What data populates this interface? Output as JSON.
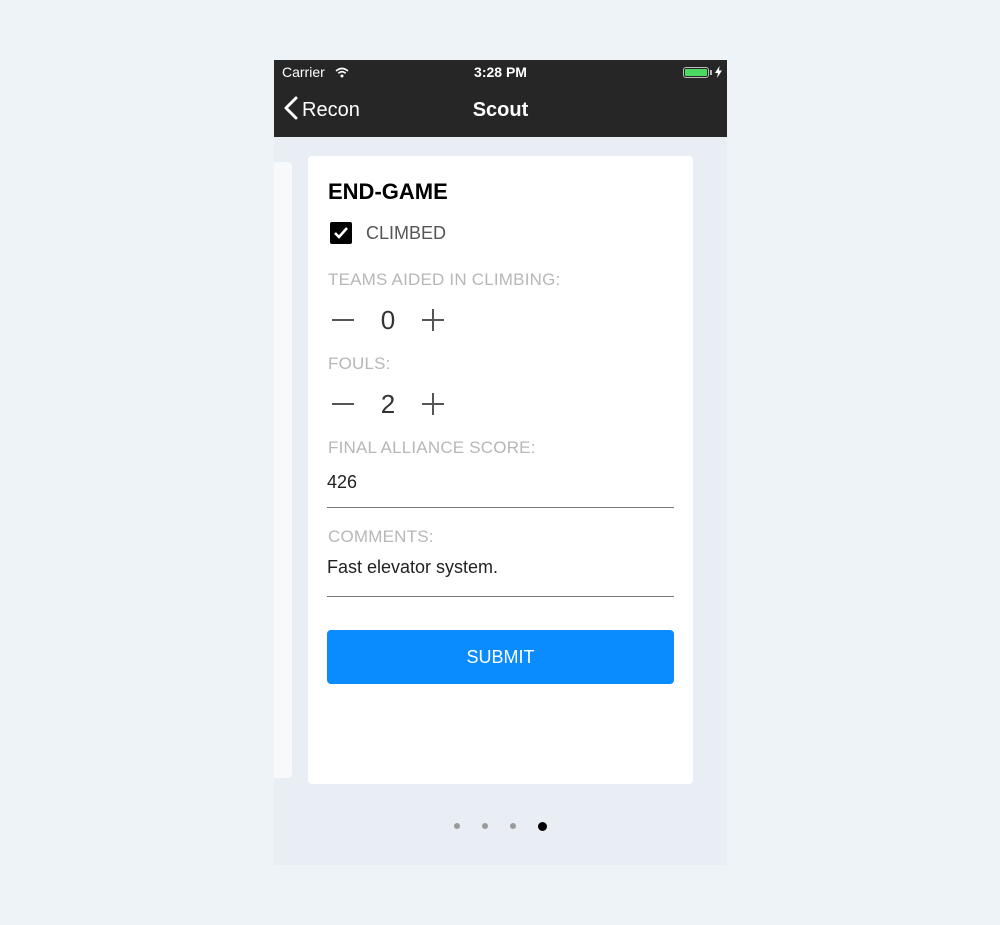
{
  "statusbar": {
    "carrier": "Carrier",
    "time": "3:28 PM"
  },
  "navbar": {
    "back_label": "Recon",
    "title": "Scout"
  },
  "form": {
    "section_title": "END-GAME",
    "climbed": {
      "label": "CLIMBED",
      "checked": true
    },
    "teams_aided": {
      "label": "TEAMS AIDED IN CLIMBING:",
      "value": "0"
    },
    "fouls": {
      "label": "FOULS:",
      "value": "2"
    },
    "final_score": {
      "label": "FINAL ALLIANCE SCORE:",
      "value": "426"
    },
    "comments": {
      "label": "COMMENTS:",
      "value": "Fast elevator system."
    },
    "submit_label": "SUBMIT"
  },
  "pager": {
    "pages": 4,
    "current": 4
  },
  "colors": {
    "accent": "#0a8bfe",
    "navbar": "#262626",
    "battery": "#4cd964"
  }
}
